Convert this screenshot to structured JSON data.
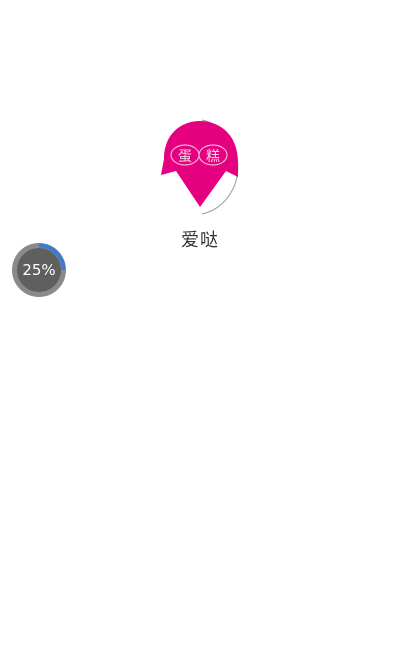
{
  "splash": {
    "logo_text": [
      "蛋",
      "糕"
    ],
    "logo_color": "#e4007f",
    "app_name": "爱哒"
  },
  "progress_bubble": {
    "label": "25%",
    "value": 0.25,
    "track_color": "#8a8a8a",
    "inner_color": "#5f5f5f",
    "fill_color": "#3a7bd5"
  }
}
